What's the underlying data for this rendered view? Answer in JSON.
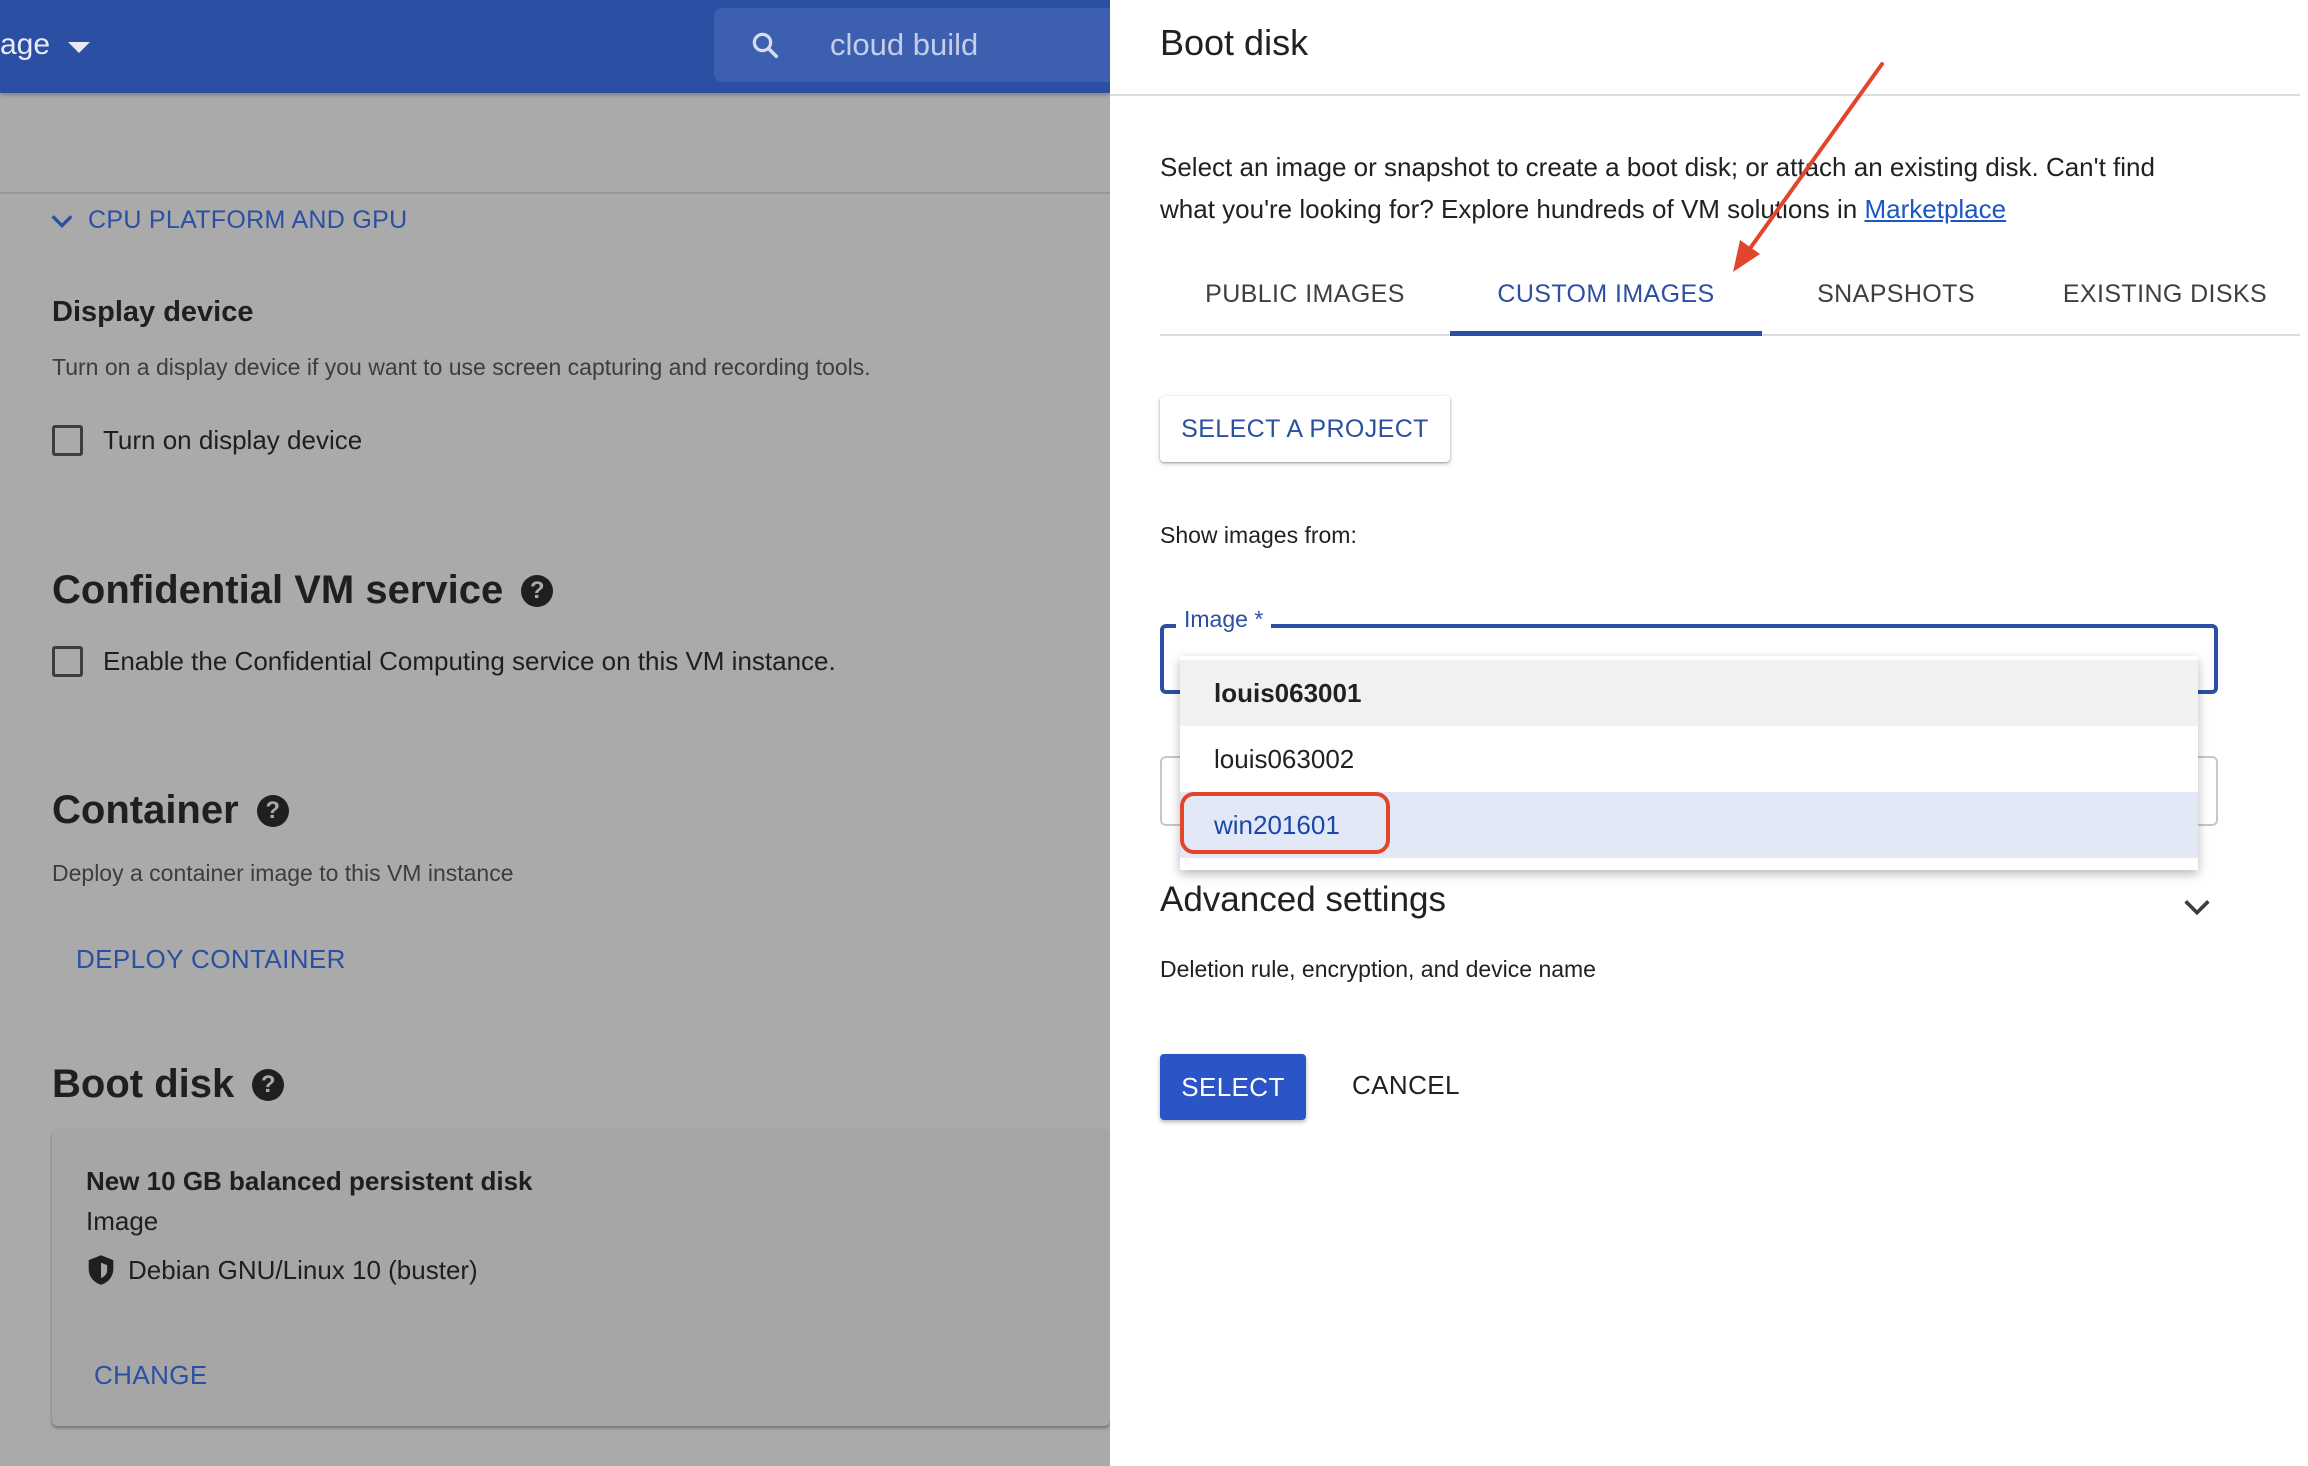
{
  "header": {
    "project_selector": "age",
    "search_text": "cloud build"
  },
  "left": {
    "cpu_section": "CPU PLATFORM AND GPU",
    "display_device": {
      "title": "Display device",
      "description": "Turn on a display device if you want to use screen capturing and recording tools.",
      "checkbox_label": "Turn on display device"
    },
    "confidential": {
      "title": "Confidential VM service",
      "checkbox_label": "Enable the Confidential Computing service on this VM instance."
    },
    "container": {
      "title": "Container",
      "description": "Deploy a container image to this VM instance",
      "button": "DEPLOY CONTAINER"
    },
    "boot_disk": {
      "title": "Boot disk",
      "disk_name": "New 10 GB balanced persistent disk",
      "type": "Image",
      "os": "Debian GNU/Linux 10 (buster)",
      "change": "CHANGE"
    },
    "help_glyph": "?"
  },
  "panel": {
    "title": "Boot disk",
    "description_line1": "Select an image or snapshot to create a boot disk; or attach an existing disk. Can't find",
    "description_line2": "what you're looking for? Explore hundreds of VM solutions in",
    "marketplace": "Marketplace",
    "tabs": [
      {
        "label": "PUBLIC IMAGES"
      },
      {
        "label": "CUSTOM IMAGES"
      },
      {
        "label": "SNAPSHOTS"
      },
      {
        "label": "EXISTING DISKS"
      }
    ],
    "active_tab": "CUSTOM IMAGES",
    "select_project": "SELECT A PROJECT",
    "show_images_from": "Show images from:",
    "image_label": "Image *",
    "image_options": [
      {
        "label": "louis063001"
      },
      {
        "label": "louis063002"
      },
      {
        "label": "win201601"
      }
    ],
    "highlighted_option": "win201601",
    "advanced": {
      "title": "Advanced settings",
      "subtitle": "Deletion rule, encryption, and device name"
    },
    "buttons": {
      "select": "SELECT",
      "cancel": "CANCEL"
    }
  },
  "colors": {
    "brand_blue": "#2b4fa3",
    "annotation_red": "#e2452b"
  },
  "icons": [
    "search-icon",
    "chevron-down-icon",
    "help-icon",
    "shield-icon",
    "annotation-arrow"
  ]
}
